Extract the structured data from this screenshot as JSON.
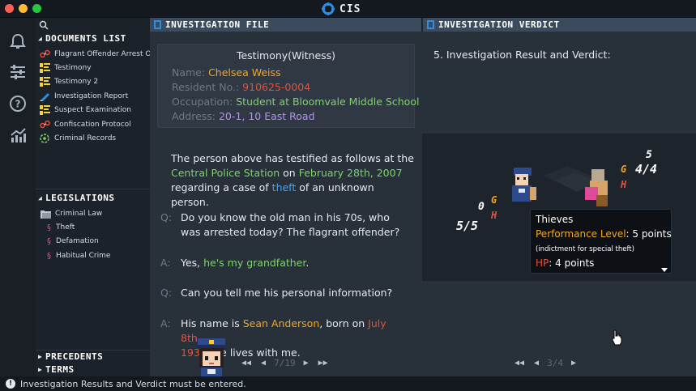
{
  "window": {
    "app_title": "CIS"
  },
  "documents": {
    "header": "DOCUMENTS LIST",
    "items": [
      {
        "label": "Flagrant Offender Arrest Order",
        "icon": "handcuffs-icon"
      },
      {
        "label": "Testimony",
        "icon": "speech-icon"
      },
      {
        "label": "Testimony 2",
        "icon": "speech-icon"
      },
      {
        "label": "Investigation Report",
        "icon": "pen-icon"
      },
      {
        "label": "Suspect Examination",
        "icon": "speech-icon"
      },
      {
        "label": "Confiscation Protocol",
        "icon": "handcuffs-icon"
      },
      {
        "label": "Criminal Records",
        "icon": "record-icon"
      }
    ]
  },
  "legislations": {
    "header": "LEGISLATIONS",
    "folder": "Criminal Law",
    "items": [
      "Theft",
      "Defamation",
      "Habitual Crime"
    ]
  },
  "bottom_sections": {
    "precedents": "PRECEDENTS",
    "terms": "TERMS"
  },
  "file_panel": {
    "header": "INVESTIGATION FILE",
    "card_title": "Testimony(Witness)",
    "fields": {
      "name_label": "Name:",
      "name_value": "Chelsea Weiss",
      "resident_label": "Resident No.:",
      "resident_value": "910625-0004",
      "occupation_label": "Occupation:",
      "occupation_value": "Student at Bloomvale Middle School",
      "address_label": "Address:",
      "address_value_a": "20-1,",
      "address_value_b": "10 East Road"
    },
    "statement": {
      "line1": "The person above has testified as follows at the",
      "station": "Central Police Station",
      "on": " on ",
      "date": "February 28th, 2007",
      "line3_a": "regarding a case of ",
      "crime": "theft",
      "line3_b": " of an unknown person."
    },
    "qa": [
      {
        "label": "Q:",
        "text": "Do you know the old man in his 70s, who was arrested today? The flagrant offender?"
      },
      {
        "label": "A:",
        "text_a": "Yes, ",
        "text_b": "he's my grandfather",
        "text_c": "."
      },
      {
        "label": "Q:",
        "text": "Can you tell me his personal information?"
      },
      {
        "label": "A:",
        "text_a": "His name is ",
        "name": "Sean Anderson",
        "text_b": ", born on ",
        "date": "July 8th,",
        "line2_a": "193",
        "line2_b": "4. He lives with me."
      }
    ],
    "pager": {
      "page": "7/19"
    }
  },
  "verdict_panel": {
    "header": "INVESTIGATION VERDICT",
    "label": "5. Investigation Result and Verdict:",
    "tooltip": {
      "name": "Thieves",
      "perf_label": "Performance Level",
      "perf_value": ": 5 points",
      "note": "(indictment for special theft)",
      "hp_label": "HP",
      "hp_value": ": 4 points"
    },
    "scene": {
      "left_score": "5/5",
      "left_g": "0",
      "right_score": "4/4",
      "right_g": "5",
      "g_letter": "G",
      "h_letter": "H"
    },
    "pager": {
      "page": "3/4"
    }
  },
  "status": {
    "message": "Investigation Results and Verdict must be entered."
  },
  "colors": {
    "accent_blue": "#2b8fe8",
    "orange": "#f5a623",
    "red": "#e8503c",
    "green": "#7ed36c",
    "purple": "#b392f0"
  }
}
